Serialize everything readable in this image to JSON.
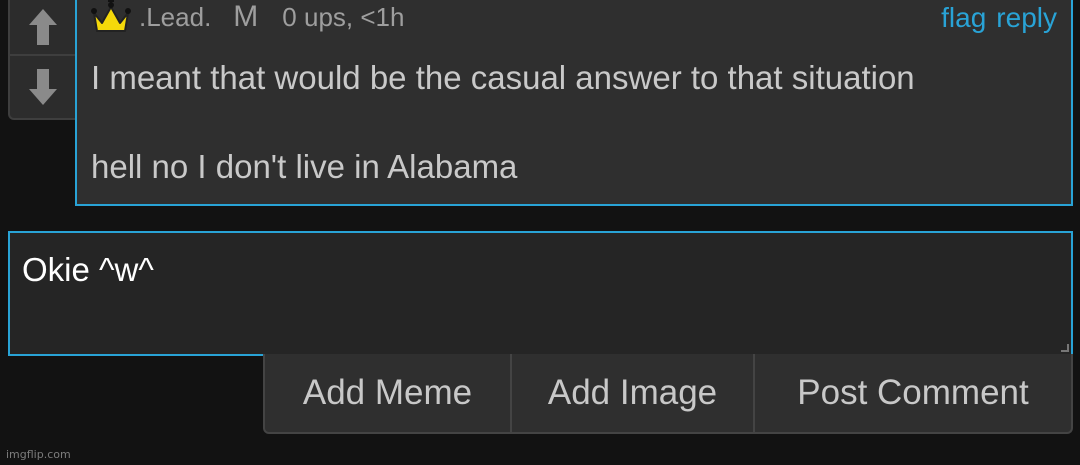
{
  "comment": {
    "username": ".Lead.",
    "gender_badge": "M",
    "meta": "0 ups, <1h",
    "actions": {
      "flag": "flag",
      "reply": "reply"
    },
    "body": [
      "I meant that would be the casual answer to that situation",
      "hell no I don't live in Alabama"
    ]
  },
  "reply": {
    "value": "Okie ^w^"
  },
  "buttons": {
    "add_meme": "Add Meme",
    "add_image": "Add Image",
    "post_comment": "Post Comment"
  },
  "watermark": "imgflip.com",
  "colors": {
    "accent": "#29a3d6",
    "background": "#121212",
    "card": "#2f2f2f",
    "crown_fill": "#f5d90a"
  },
  "icons": {
    "upvote": "arrow-up-icon",
    "downvote": "arrow-down-icon",
    "user_badge": "crown-icon"
  }
}
